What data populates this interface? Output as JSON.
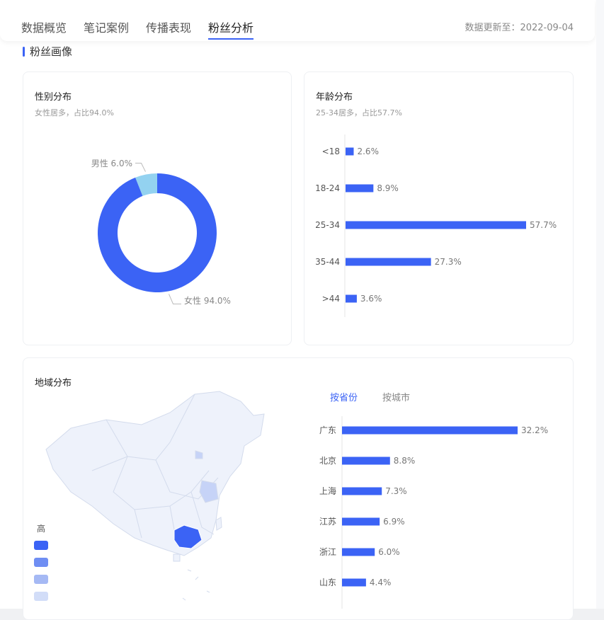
{
  "tabs": [
    {
      "label": "数据概览"
    },
    {
      "label": "笔记案例"
    },
    {
      "label": "传播表现"
    },
    {
      "label": "粉丝分析"
    }
  ],
  "active_tab": "粉丝分析",
  "update_text": "数据更新至：2022-09-04",
  "section_title": "粉丝画像",
  "gender": {
    "title": "性别分布",
    "subtitle": "女性居多，占比94.0%"
  },
  "age": {
    "title": "年龄分布",
    "subtitle": "25-34居多，占比57.7%"
  },
  "region": {
    "title": "地域分布",
    "tabs": [
      "按省份",
      "按城市"
    ],
    "legend_high": "高"
  },
  "colors": {
    "primary": "#3b63f5",
    "secondary": "#93d2f0",
    "grey_text": "#999999"
  },
  "chart_data": [
    {
      "type": "pie",
      "title": "性别分布",
      "categories": [
        "男性",
        "女性"
      ],
      "values": [
        6.0,
        94.0
      ],
      "value_labels": [
        "男性 6.0%",
        "女性 94.0%"
      ],
      "donut": true
    },
    {
      "type": "bar",
      "title": "年龄分布",
      "orientation": "horizontal",
      "categories": [
        "<18",
        "18-24",
        "25-34",
        "35-44",
        ">44"
      ],
      "values": [
        2.6,
        8.9,
        57.7,
        27.3,
        3.6
      ],
      "value_labels": [
        "2.6%",
        "8.9%",
        "57.7%",
        "27.3%",
        "3.6%"
      ]
    },
    {
      "type": "bar",
      "title": "地域分布",
      "orientation": "horizontal",
      "categories": [
        "广东",
        "北京",
        "上海",
        "江苏",
        "浙江",
        "山东"
      ],
      "values": [
        32.2,
        8.8,
        7.3,
        6.9,
        6.0,
        4.4
      ],
      "value_labels": [
        "32.2%",
        "8.8%",
        "7.3%",
        "6.9%",
        "6.0%",
        "4.4%"
      ]
    }
  ]
}
